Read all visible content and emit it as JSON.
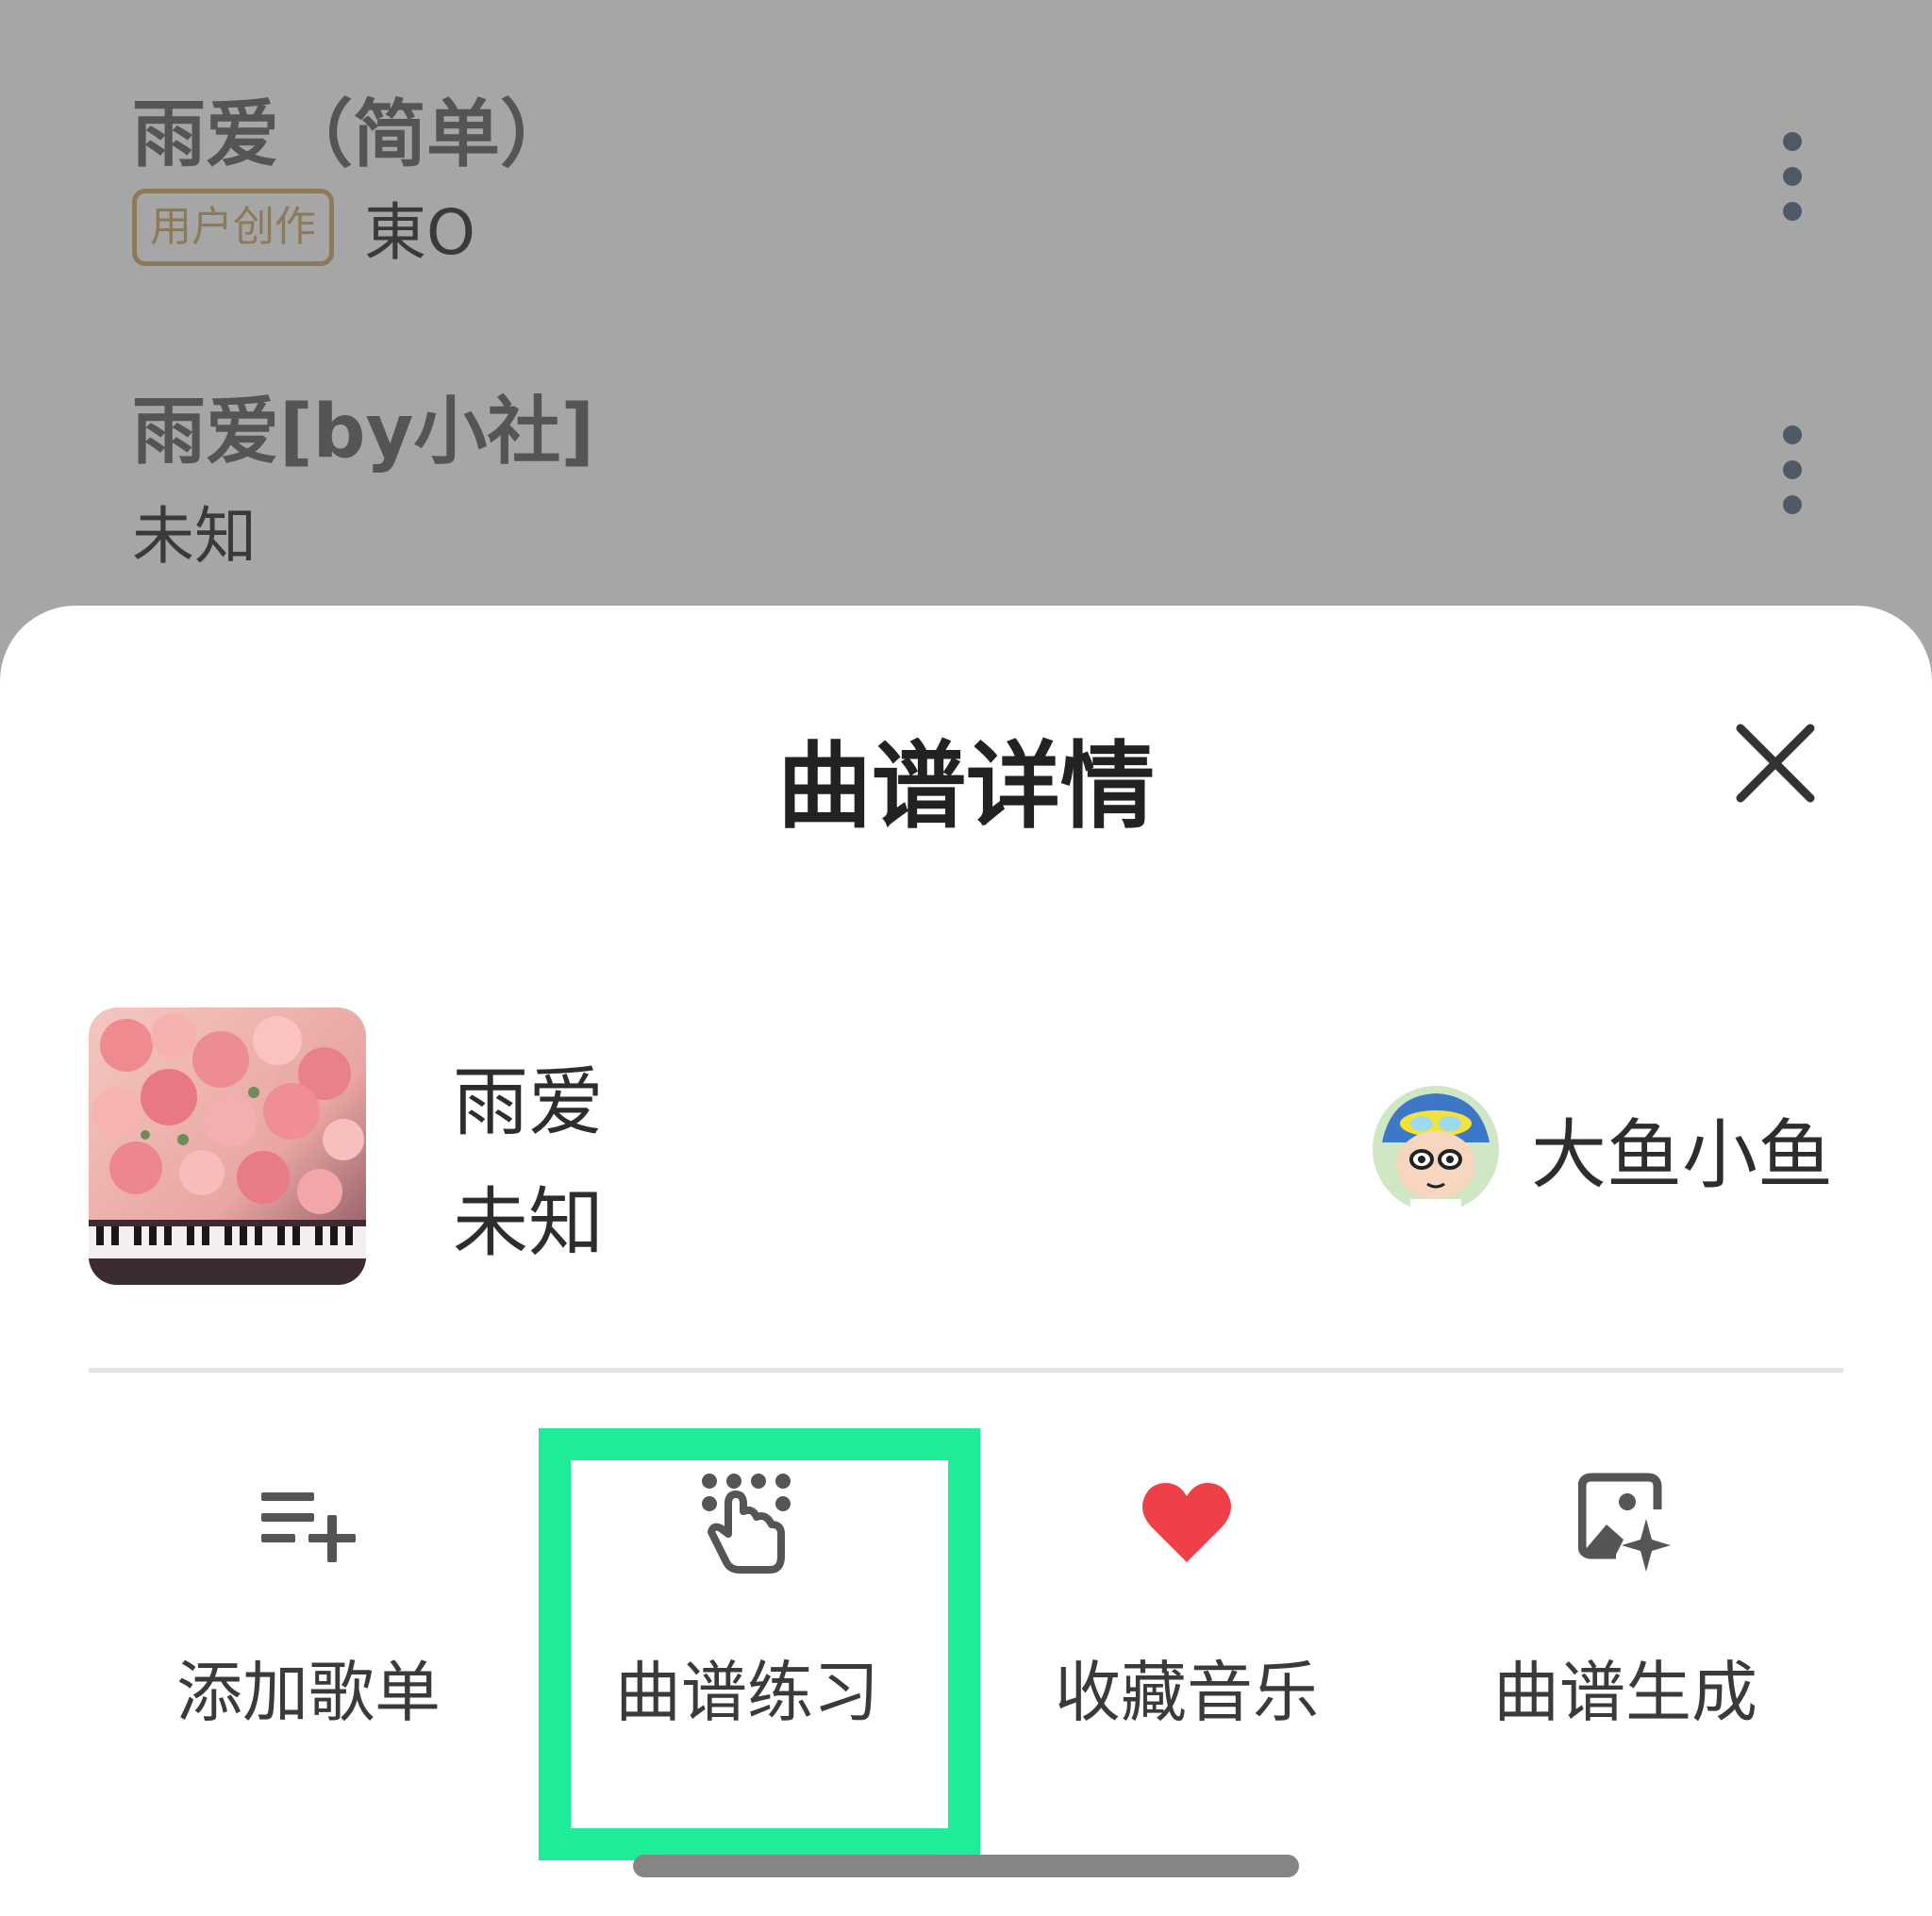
{
  "background_list": {
    "items": [
      {
        "title": "雨爱（简单）",
        "tag": "用户创作",
        "author": "東O"
      },
      {
        "title": "雨爱[by小社]",
        "author": "未知"
      }
    ]
  },
  "sheet": {
    "title": "曲谱详情",
    "song": {
      "name": "雨爱",
      "artist": "未知"
    },
    "uploader": {
      "name": "大鱼小鱼"
    },
    "actions": [
      {
        "label": "添加歌单",
        "icon": "playlist-add-icon"
      },
      {
        "label": "曲谱练习",
        "icon": "tap-practice-icon"
      },
      {
        "label": "收藏音乐",
        "icon": "heart-icon"
      },
      {
        "label": "曲谱生成",
        "icon": "image-sparkle-icon"
      }
    ]
  },
  "colors": {
    "highlight": "#1eec96",
    "heart": "#ef4048",
    "tag": "#8c7a59"
  }
}
